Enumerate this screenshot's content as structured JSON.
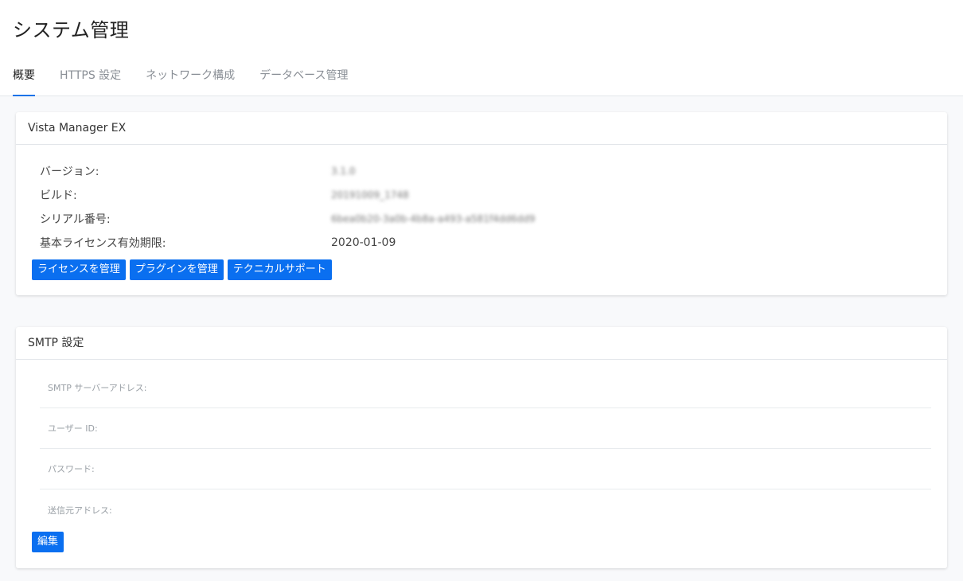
{
  "page": {
    "title": "システム管理"
  },
  "tabs": [
    {
      "label": "概要",
      "active": true
    },
    {
      "label": "HTTPS 設定",
      "active": false
    },
    {
      "label": "ネットワーク構成",
      "active": false
    },
    {
      "label": "データベース管理",
      "active": false
    }
  ],
  "vista": {
    "title": "Vista Manager EX",
    "rows": [
      {
        "label": "バージョン:",
        "value": "3.1.0"
      },
      {
        "label": "ビルド:",
        "value": "20191009_1748"
      },
      {
        "label": "シリアル番号:",
        "value": "6bea0b20-3a0b-4b8a-a493-a581f4dd6dd9"
      },
      {
        "label": "基本ライセンス有効期限:",
        "value": "2020-01-09"
      }
    ],
    "buttons": {
      "license": "ライセンスを管理",
      "plugin": "プラグインを管理",
      "support": "テクニカルサポート"
    }
  },
  "smtp": {
    "title": "SMTP 設定",
    "fields": [
      {
        "label": "SMTP サーバーアドレス:"
      },
      {
        "label": "ユーザー ID:"
      },
      {
        "label": "パスワード:"
      },
      {
        "label": "送信元アドレス:"
      }
    ],
    "edit_label": "編集"
  },
  "colors": {
    "accent": "#0a6ff0",
    "tab_underline": "#1a73e8",
    "background": "#f8f9fb"
  }
}
